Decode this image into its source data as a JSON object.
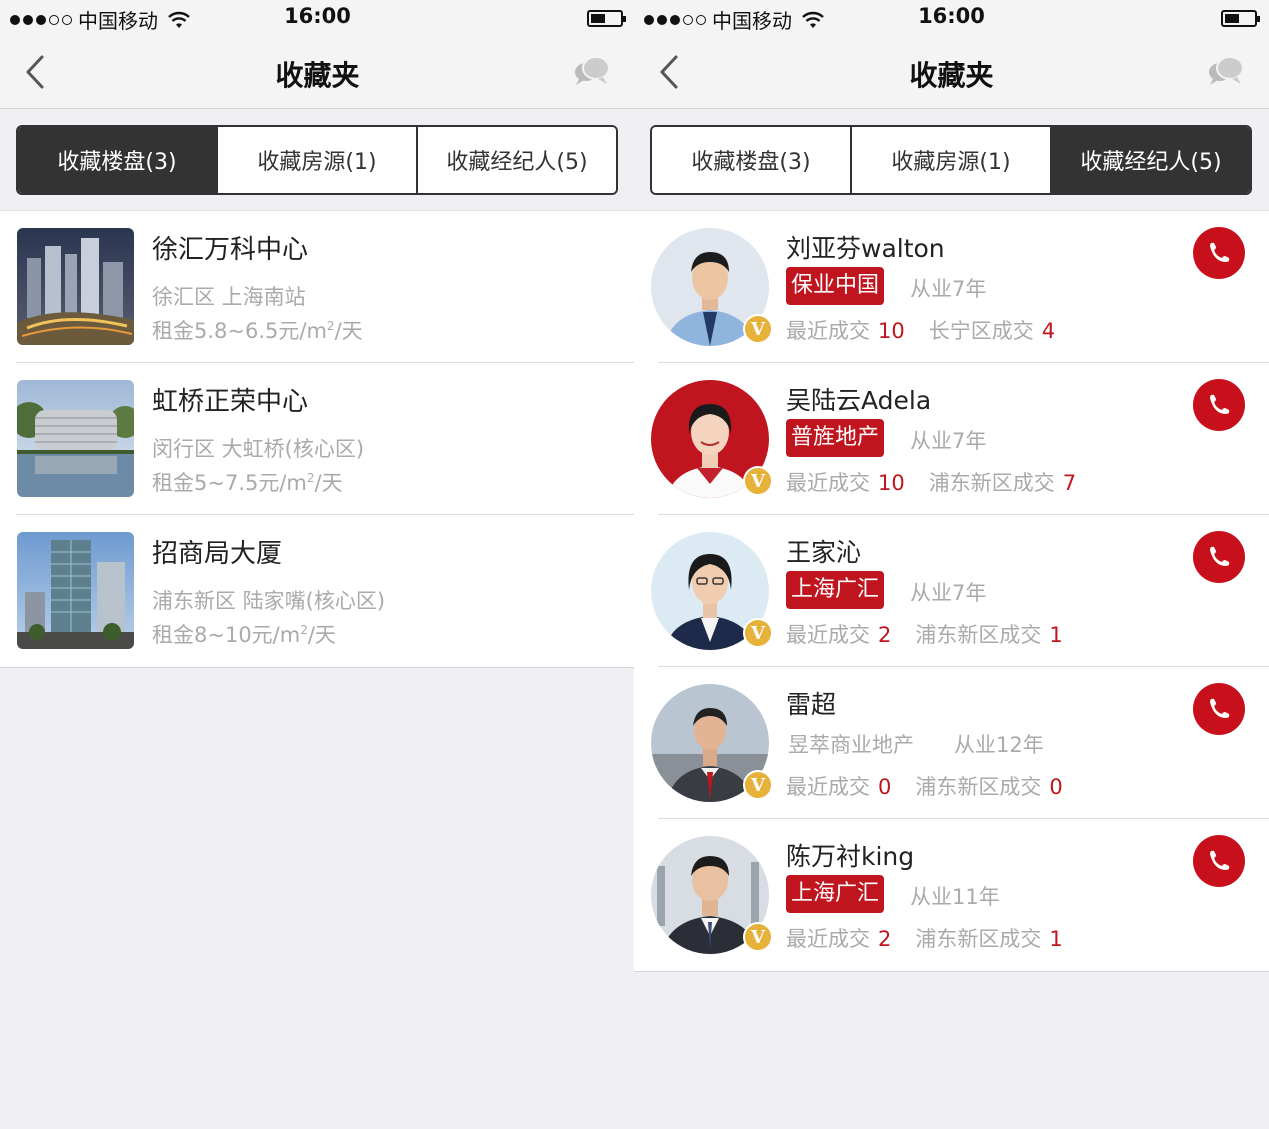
{
  "left_screen": {
    "status": {
      "carrier": "中国移动",
      "time": "16:00"
    },
    "nav": {
      "title": "收藏夹"
    },
    "tabs": [
      {
        "label": "收藏楼盘(3)",
        "active": true
      },
      {
        "label": "收藏房源(1)",
        "active": false
      },
      {
        "label": "收藏经纪人(5)",
        "active": false
      }
    ],
    "properties": [
      {
        "name": "徐汇万科中心",
        "location": "徐汇区 上海南站",
        "price_prefix": "租金5.8~6.5元/m",
        "price_sup": "2",
        "price_suffix": "/天"
      },
      {
        "name": "虹桥正荣中心",
        "location": "闵行区 大虹桥(核心区)",
        "price_prefix": "租金5~7.5元/m",
        "price_sup": "2",
        "price_suffix": "/天"
      },
      {
        "name": "招商局大厦",
        "location": "浦东新区 陆家嘴(核心区)",
        "price_prefix": "租金8~10元/m",
        "price_sup": "2",
        "price_suffix": "/天"
      }
    ]
  },
  "right_screen": {
    "status": {
      "carrier": "中国移动",
      "time": "16:00"
    },
    "nav": {
      "title": "收藏夹"
    },
    "tabs": [
      {
        "label": "收藏楼盘(3)",
        "active": false
      },
      {
        "label": "收藏房源(1)",
        "active": false
      },
      {
        "label": "收藏经纪人(5)",
        "active": true
      }
    ],
    "agents": [
      {
        "name": "刘亚芬walton",
        "company": "保业中国",
        "company_tagged": true,
        "years": "从业7年",
        "recent_label": "最近成交",
        "recent": "10",
        "district_label": "长宁区成交",
        "district": "4",
        "badge": "V"
      },
      {
        "name": "吴陆云Adela",
        "company": "普旌地产",
        "company_tagged": true,
        "years": "从业7年",
        "recent_label": "最近成交",
        "recent": "10",
        "district_label": "浦东新区成交",
        "district": "7",
        "badge": "V"
      },
      {
        "name": "王家沁",
        "company": "上海广汇",
        "company_tagged": true,
        "years": "从业7年",
        "recent_label": "最近成交",
        "recent": "2",
        "district_label": "浦东新区成交",
        "district": "1",
        "badge": "V"
      },
      {
        "name": "雷超",
        "company": "昱萃商业地产",
        "company_tagged": false,
        "years": "从业12年",
        "recent_label": "最近成交",
        "recent": "0",
        "district_label": "浦东新区成交",
        "district": "0",
        "badge": "V"
      },
      {
        "name": "陈万衬king",
        "company": "上海广汇",
        "company_tagged": true,
        "years": "从业11年",
        "recent_label": "最近成交",
        "recent": "2",
        "district_label": "浦东新区成交",
        "district": "1",
        "badge": "V"
      }
    ]
  },
  "colors": {
    "accent_red": "#c0141e",
    "tab_active_bg": "#333333",
    "muted_text": "#aaaaaa",
    "verified_gold": "#e6b23a"
  },
  "icons": [
    "back-chevron-icon",
    "chat-bubbles-icon",
    "wifi-icon",
    "battery-icon",
    "phone-call-icon",
    "verified-v-icon"
  ]
}
